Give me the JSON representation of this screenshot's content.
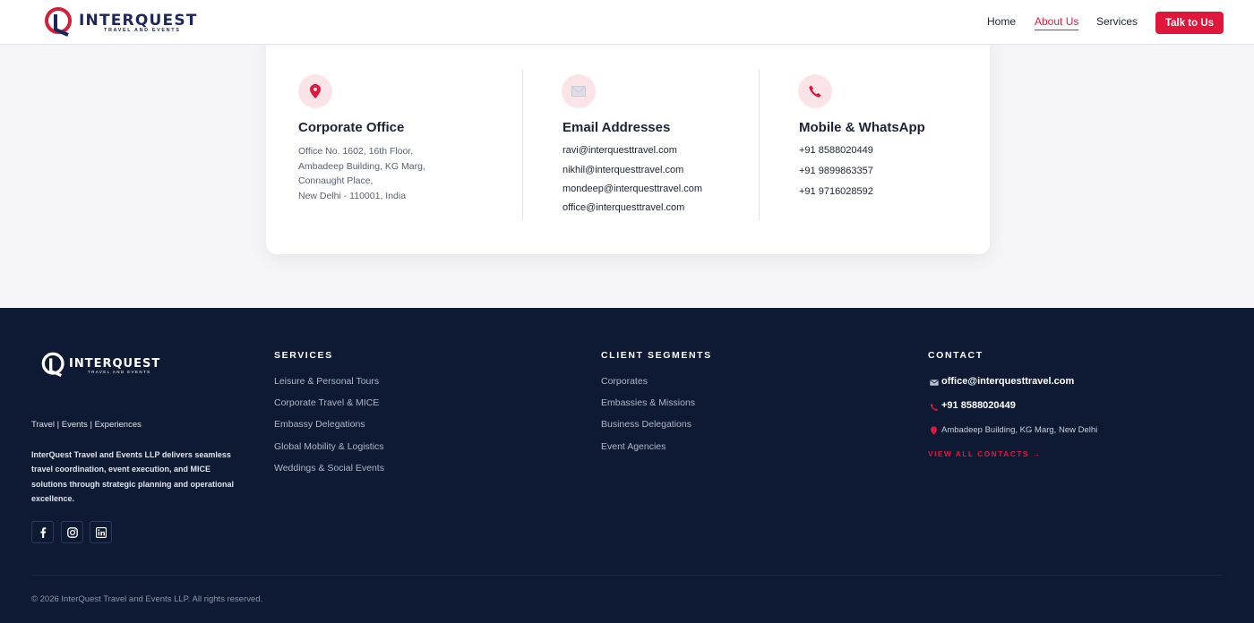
{
  "header": {
    "logo_text": "INTERQUEST",
    "logo_subtext": "TRAVEL AND EVENTS",
    "nav": [
      {
        "label": "Home"
      },
      {
        "label": "About Us"
      },
      {
        "label": "Services"
      }
    ],
    "cta_label": "Talk to Us"
  },
  "contact_card": {
    "office": {
      "title": "Corporate Office",
      "lines": [
        "Office No. 1602, 16th Floor,",
        "Ambadeep Building, KG Marg,",
        "Connaught Place,",
        "New Delhi - 110001, India"
      ]
    },
    "emails": {
      "title": "Email Addresses",
      "items": [
        "ravi@interquesttravel.com",
        "nikhil@interquesttravel.com",
        "mondeep@interquesttravel.com",
        "office@interquesttravel.com"
      ]
    },
    "phones": {
      "title": "Mobile & WhatsApp",
      "items": [
        "+91 8588020449",
        "+91 9899863357",
        "+91 9716028592"
      ]
    }
  },
  "footer": {
    "logo_text": "INTERQUEST",
    "logo_subtext": "TRAVEL AND EVENTS",
    "tagline": "Travel | Events | Experiences",
    "description": "InterQuest Travel and Events LLP delivers seamless travel coordination, event execution, and MICE solutions through strategic planning and operational excellence.",
    "services": {
      "heading": "SERVICES",
      "items": [
        "Leisure & Personal Tours",
        "Corporate Travel & MICE",
        "Embassy Delegations",
        "Global Mobility & Logistics",
        "Weddings & Social Events"
      ]
    },
    "segments": {
      "heading": "CLIENT SEGMENTS",
      "items": [
        "Corporates",
        "Embassies & Missions",
        "Business Delegations",
        "Event Agencies"
      ]
    },
    "contact": {
      "heading": "CONTACT",
      "email": "office@interquesttravel.com",
      "phone": "+91 8588020449",
      "address": "Ambadeep Building, KG Marg, New Delhi",
      "view_all": "VIEW ALL CONTACTS →"
    },
    "copyright": "© 2026 InterQuest Travel and Events LLP. All rights reserved."
  },
  "colors": {
    "accent": "#e0173a",
    "navy": "#1d2657",
    "footer_bg": "#0e1a33"
  },
  "icons": [
    "location-pin-icon",
    "envelope-icon",
    "phone-icon",
    "facebook-icon",
    "instagram-icon",
    "linkedin-icon"
  ]
}
